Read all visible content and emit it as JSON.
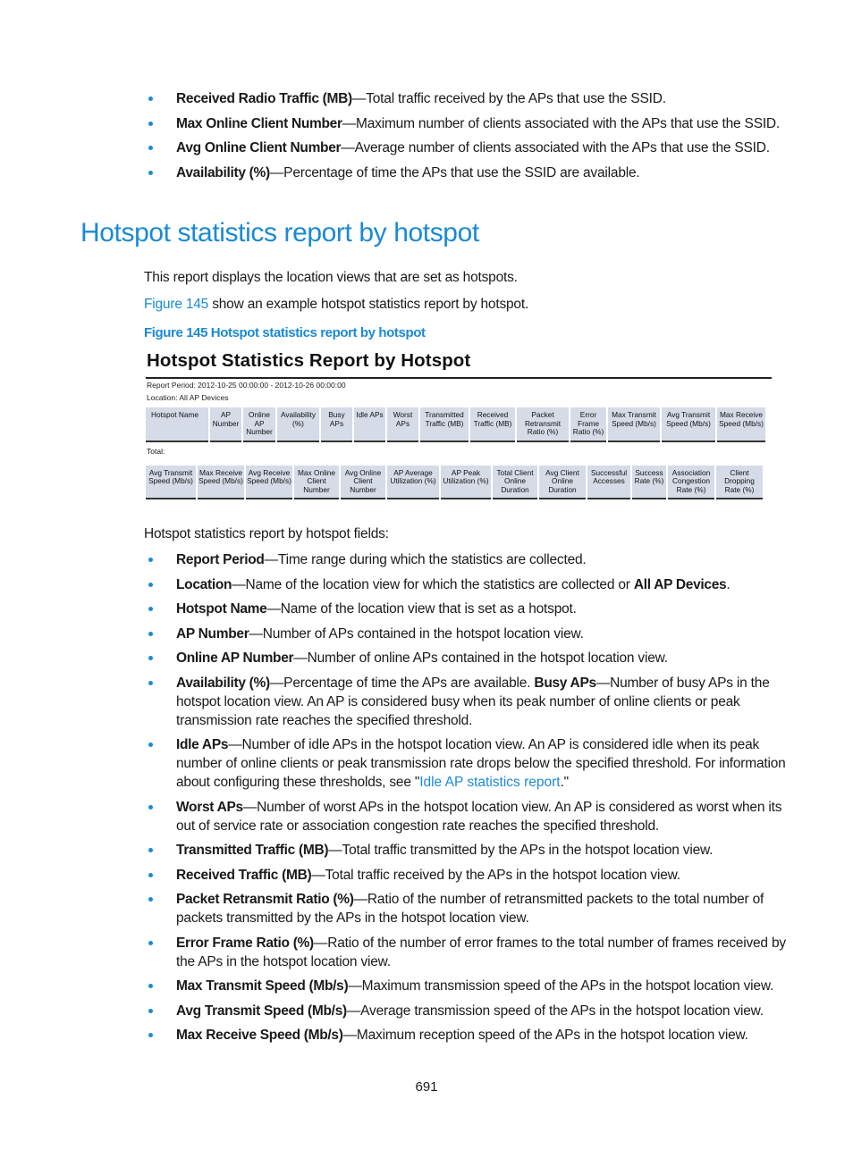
{
  "top_bullets": [
    {
      "term": "Received Radio Traffic (MB)",
      "desc": "—Total traffic received by the APs that use the SSID."
    },
    {
      "term": "Max Online Client Number",
      "desc": "—Maximum number of clients associated with the APs that use the SSID."
    },
    {
      "term": "Avg Online Client Number",
      "desc": "—Average number of clients associated with the APs that use the SSID."
    },
    {
      "term": "Availability (%)",
      "desc": "—Percentage of time the APs that use the SSID are available."
    }
  ],
  "section_title": "Hotspot statistics report by hotspot",
  "intro_text": "This report displays the location views that are set as hotspots.",
  "figure_ref": {
    "link": "Figure 145",
    "text": " show an example hotspot statistics report by hotspot."
  },
  "figure_caption": "Figure 145 Hotspot statistics report by hotspot",
  "figure": {
    "title": "Hotspot Statistics Report by Hotspot",
    "report_period": "Report Period: 2012-10-25 00:00:00  -  2012-10-26 00:00:00",
    "location": "Location: All AP Devices",
    "table1_headers": [
      "Hotspot Name",
      "AP Number",
      "Online AP Number",
      "Availability (%)",
      "Busy APs",
      "Idle APs",
      "Worst APs",
      "Transmitted Traffic (MB)",
      "Received Traffic (MB)",
      "Packet Retransmit Ratio (%)",
      "Error Frame Ratio (%)",
      "Max Transmit Speed (Mb/s)",
      "Avg Transmit Speed (Mb/s)",
      "Max Receive Speed (Mb/s)"
    ],
    "total_label": "Total:",
    "table2_headers": [
      "Avg Transmit Speed (Mb/s)",
      "Max Receive Speed (Mb/s)",
      "Avg Receive Speed (Mb/s)",
      "Max Online Client Number",
      "Avg Online Client Number",
      "AP Average Utilization (%)",
      "AP Peak Utilization (%)",
      "Total Client Online Duration",
      "Avg Client Online Duration",
      "Successful Accesses",
      "Success Rate (%)",
      "Association Congestion Rate (%)",
      "Client Dropping Rate (%)"
    ]
  },
  "fields_intro": "Hotspot statistics report by hotspot fields:",
  "fields": [
    {
      "term": "Report Period",
      "desc": "—Time range during which the statistics are collected."
    },
    {
      "term": "Location",
      "desc": "—Name of the location view for which the statistics are collected or ",
      "term2": "All AP Devices",
      "desc2": "."
    },
    {
      "term": "Hotspot Name",
      "desc": "—Name of the location view that is set as a hotspot."
    },
    {
      "term": "AP Number",
      "desc": "—Number of APs contained in the hotspot location view."
    },
    {
      "term": "Online AP Number",
      "desc": "—Number of online APs contained in the hotspot location view."
    },
    {
      "term": "Availability (%)",
      "desc": "—Percentage of time the APs are available. ",
      "term2": "Busy APs",
      "desc2": "—Number of busy APs in the hotspot location view. An AP is considered busy when its peak number of online clients or peak transmission rate reaches the specified threshold."
    },
    {
      "term": "Idle APs",
      "desc": "—Number of idle APs in the hotspot location view. An AP is considered idle when its peak number of online clients or peak transmission rate drops below the specified threshold. For information about configuring these thresholds, see \"",
      "link": "Idle AP statistics report",
      "desc2": ".\""
    },
    {
      "term": "Worst APs",
      "desc": "—Number of worst APs in the hotspot location view. An AP is considered as worst when its out of service rate or association congestion rate reaches the specified threshold."
    },
    {
      "term": "Transmitted Traffic (MB)",
      "desc": "—Total traffic transmitted by the APs in the hotspot location view."
    },
    {
      "term": "Received Traffic (MB)",
      "desc": "—Total traffic received by the APs in the hotspot location view."
    },
    {
      "term": "Packet Retransmit Ratio (%)",
      "desc": "—Ratio of the number of retransmitted packets to the total number of packets transmitted by the APs in the hotspot location view."
    },
    {
      "term": "Error Frame Ratio (%)",
      "desc": "—Ratio of the number of error frames to the total number of frames received by the APs in the hotspot location view."
    },
    {
      "term": "Max Transmit Speed (Mb/s)",
      "desc": "—Maximum transmission speed of the APs in the hotspot location view."
    },
    {
      "term": "Avg Transmit Speed (Mb/s)",
      "desc": "—Average transmission speed of the APs in the hotspot location view."
    },
    {
      "term": "Max Receive Speed (Mb/s)",
      "desc": "—Maximum reception speed of the APs in the hotspot location view."
    }
  ],
  "page_number": "691",
  "colors": {
    "accent": "#1a8ad4",
    "table_header_bg": "#d6dbe8"
  }
}
